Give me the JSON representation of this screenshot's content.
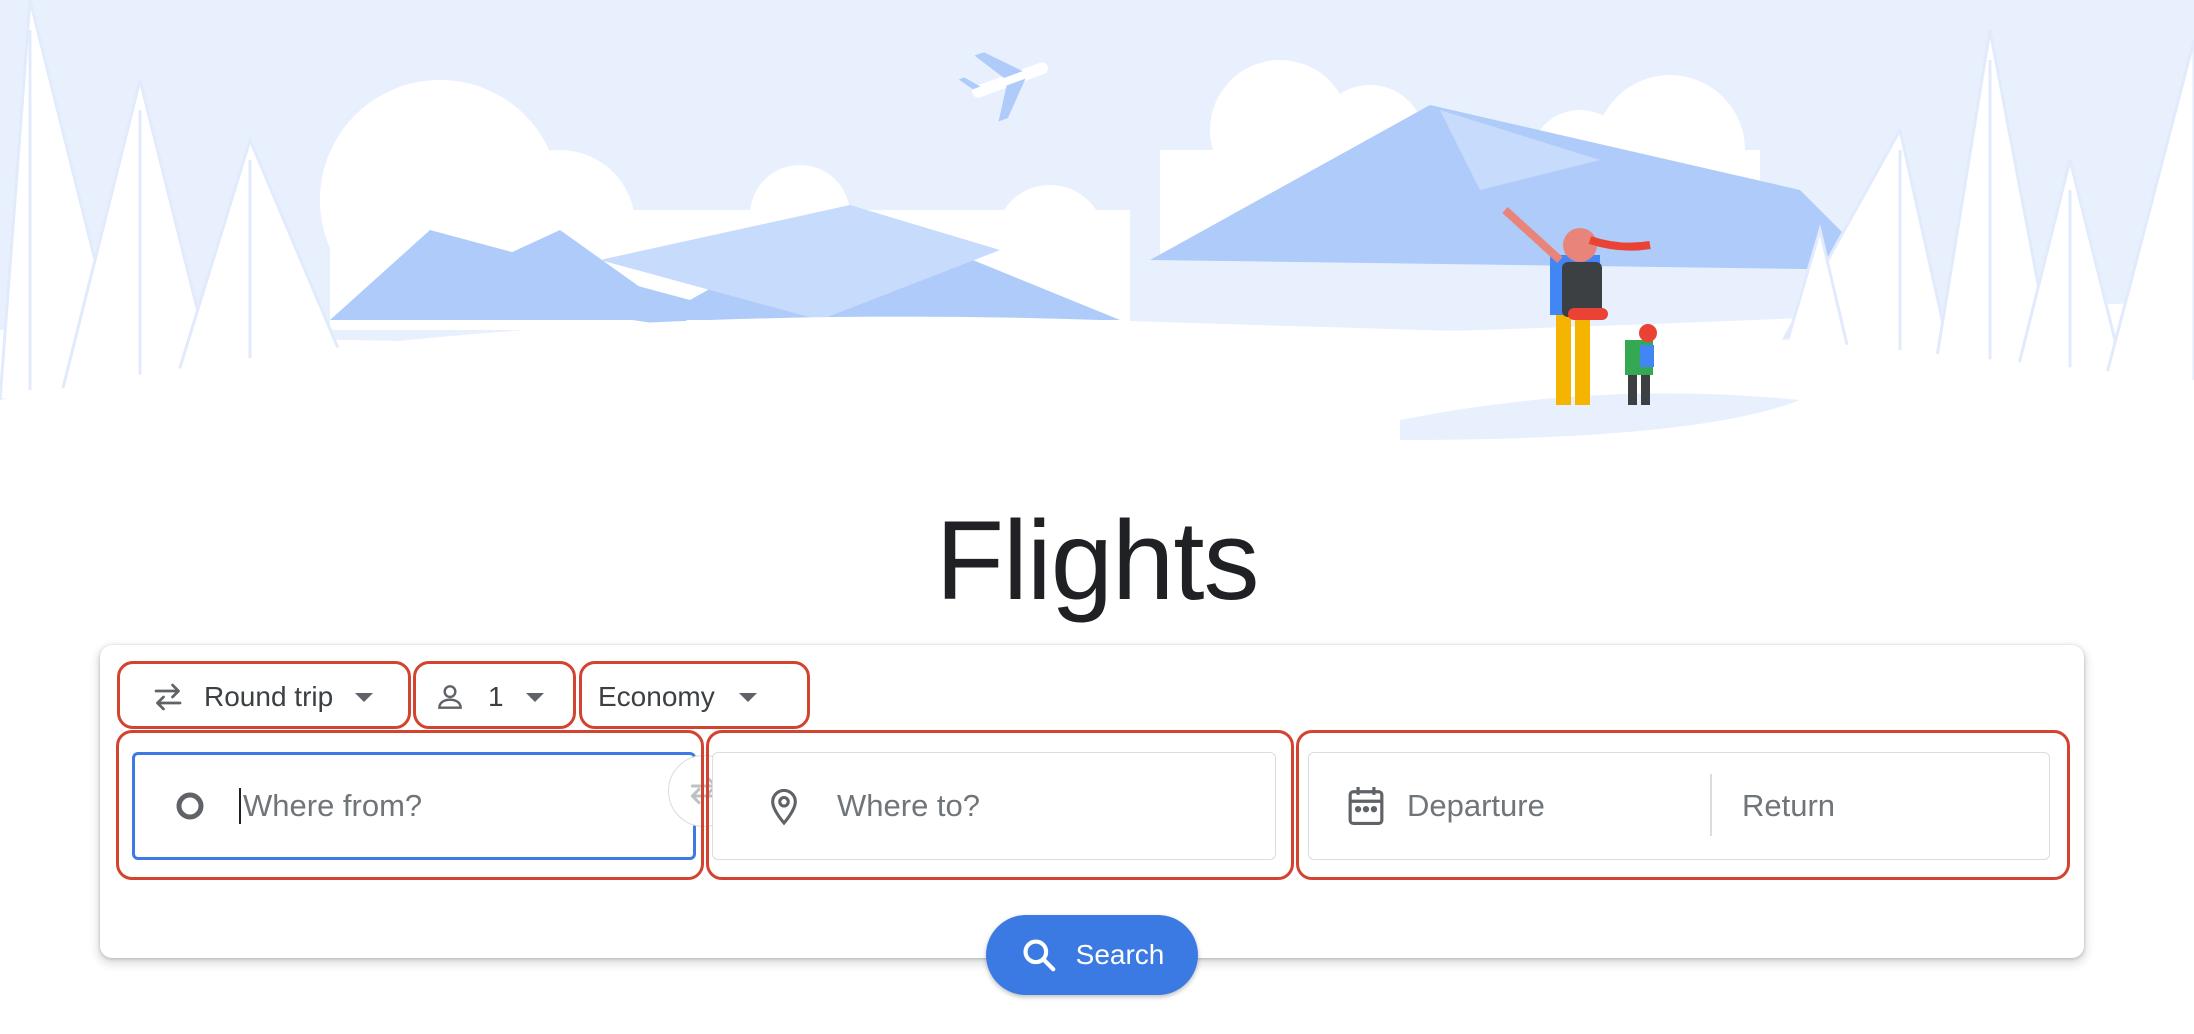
{
  "page": {
    "title": "Flights"
  },
  "search_card": {
    "trip_type": {
      "label": "Round trip",
      "icon": "swap-horiz-icon"
    },
    "passengers": {
      "count": "1",
      "icon": "person-icon"
    },
    "cabin_class": {
      "label": "Economy"
    },
    "origin": {
      "placeholder": "Where from?",
      "icon": "origin-circle-icon"
    },
    "destination": {
      "placeholder": "Where to?",
      "icon": "location-pin-icon"
    },
    "dates": {
      "departure_placeholder": "Departure",
      "return_placeholder": "Return",
      "icon": "calendar-icon"
    },
    "search_button": {
      "label": "Search",
      "icon": "search-icon"
    }
  },
  "colors": {
    "accent": "#3a7ae2",
    "active_border": "#3f79e4",
    "highlight_outline": "#d2442f",
    "sky": "#e8f0fe",
    "mountain": "#aecbfa"
  }
}
